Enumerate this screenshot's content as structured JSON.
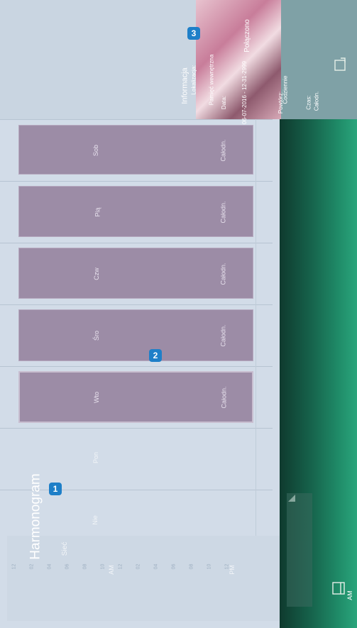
{
  "header": {
    "title": "Harmonogram",
    "network": "Sieć",
    "am": "AM",
    "pm": "PM"
  },
  "days": [
    {
      "label": "Nie"
    },
    {
      "label": "Pon"
    },
    {
      "label": "Wto",
      "duration": "Całodn."
    },
    {
      "label": "Śro",
      "duration": "Całodn."
    },
    {
      "label": "Czw",
      "duration": "Całodn."
    },
    {
      "label": "Pią",
      "duration": "Całodn."
    },
    {
      "label": "Sob",
      "duration": "Całodn."
    }
  ],
  "time_ticks": [
    "12",
    "02",
    "04",
    "06",
    "08",
    "10",
    "12",
    "02",
    "04",
    "06",
    "08",
    "10",
    "12"
  ],
  "info": {
    "status": "Połączono",
    "title": "Informacja",
    "location_label": "Lokalizacja:",
    "location_value": "Pamięć wewnętrzna",
    "date_label": "Data:",
    "date_value": "06-07-2016 - 12-31-2999",
    "repeat_label": "Powtórz:",
    "repeat_value": "Codziennie",
    "time_label": "Czas:",
    "time_value": "Całodn."
  },
  "bottom": {
    "am": "AM"
  },
  "badges": [
    "1",
    "2",
    "3"
  ]
}
